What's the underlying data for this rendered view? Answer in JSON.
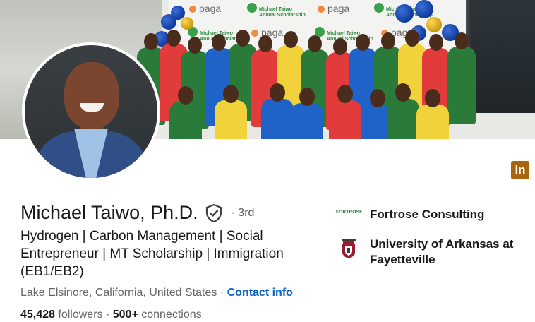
{
  "profile": {
    "name": "Michael Taiwo, Ph.D.",
    "degree": "· 3rd",
    "headline": "Hydrogen | Carbon Management | Social Entrepreneur | MT Scholarship | Immigration (EB1/EB2)",
    "location": "Lake Elsinore, California, United States",
    "location_sep": " · ",
    "contact_label": "Contact info",
    "followers": "45,428",
    "followers_label": "followers",
    "connections_sep": " · ",
    "connections": "500+",
    "connections_label": "connections"
  },
  "banner": {
    "logo_text": "paga",
    "badge_line1": "Michael Taiwo",
    "badge_line2": "Annual Scholarship"
  },
  "experience": [
    {
      "logo_text": "FORTROSE",
      "name": "Fortrose Consulting"
    },
    {
      "logo_text": "",
      "name": "University of Arkansas at Fayetteville"
    }
  ],
  "icons": {
    "linkedin": "linkedin-icon",
    "verified": "verified-shield-icon"
  },
  "colors": {
    "link": "#0a66c2",
    "linkedin_badge": "#a8650d",
    "text_primary": "#191919",
    "text_secondary": "#666666"
  }
}
